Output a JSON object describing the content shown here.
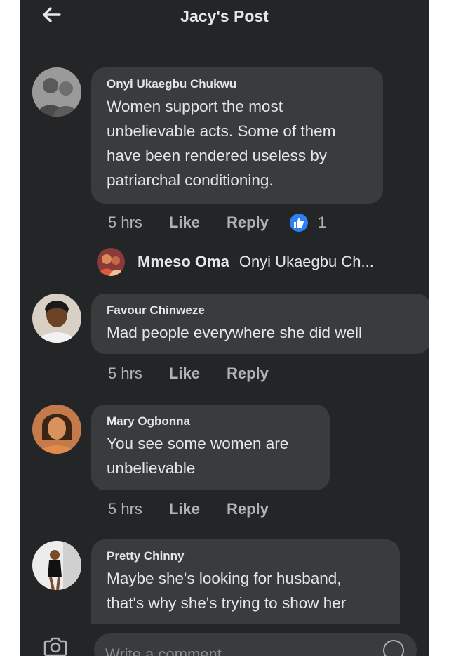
{
  "header": {
    "title": "Jacy's Post",
    "back_icon": "arrow-left-icon"
  },
  "comments": [
    {
      "author": "Onyi Ukaegbu Chukwu",
      "lines": [
        "Women support the most",
        "unbelievable acts. Some of them",
        "have been rendered useless by",
        "patriarchal conditioning."
      ],
      "time": "5 hrs",
      "like_label": "Like",
      "reply_label": "Reply",
      "reaction_count": "1"
    },
    {
      "author": "Favour Chinweze",
      "lines": [
        "Mad people everywhere she did well"
      ],
      "time": "5 hrs",
      "like_label": "Like",
      "reply_label": "Reply"
    },
    {
      "author": "Mary Ogbonna",
      "lines": [
        "You see some women are",
        "unbelievable"
      ],
      "time": "5 hrs",
      "like_label": "Like",
      "reply_label": "Reply"
    },
    {
      "author": "Pretty Chinny",
      "lines": [
        "Maybe she's looking for husband,",
        "that's why she's trying to show her"
      ]
    }
  ],
  "reply_preview": {
    "name": "Mmeso Oma",
    "snippet": "Onyi Ukaegbu Ch..."
  },
  "composer": {
    "placeholder": "Write a comment..."
  },
  "colors": {
    "background": "#242526",
    "bubble": "#3a3b3c",
    "text": "#e4e6eb",
    "muted": "#b0b3b8",
    "like_blue": "#2e81f4"
  }
}
